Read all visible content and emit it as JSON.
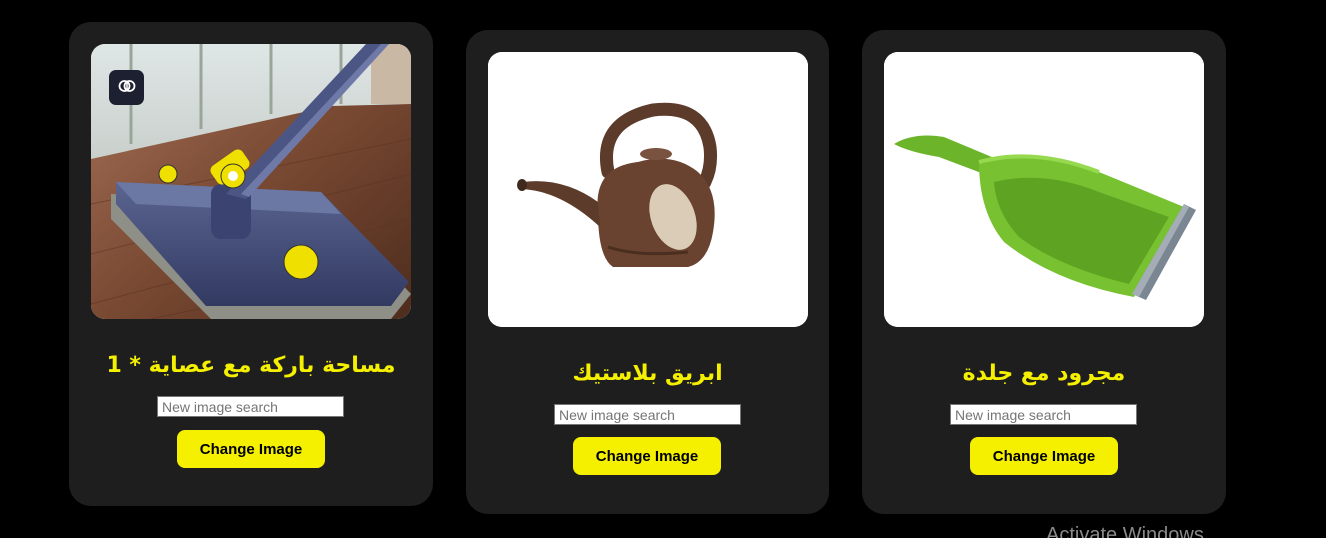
{
  "cards": [
    {
      "title": "مساحة باركة مع عصاية * 1",
      "search_placeholder": "New image search",
      "button_label": "Change Image",
      "image": "mop-photo",
      "badge_icon": "brain-icon"
    },
    {
      "title": "ابريق بلاستيك",
      "search_placeholder": "New image search",
      "button_label": "Change Image",
      "image": "watering-can-photo"
    },
    {
      "title": "مجرود مع جلدة",
      "search_placeholder": "New image search",
      "button_label": "Change Image",
      "image": "dustpan-photo"
    }
  ],
  "watermark": "Activate Windows",
  "colors": {
    "background": "#000000",
    "card": "#1e1e1e",
    "accent": "#f4f000"
  }
}
